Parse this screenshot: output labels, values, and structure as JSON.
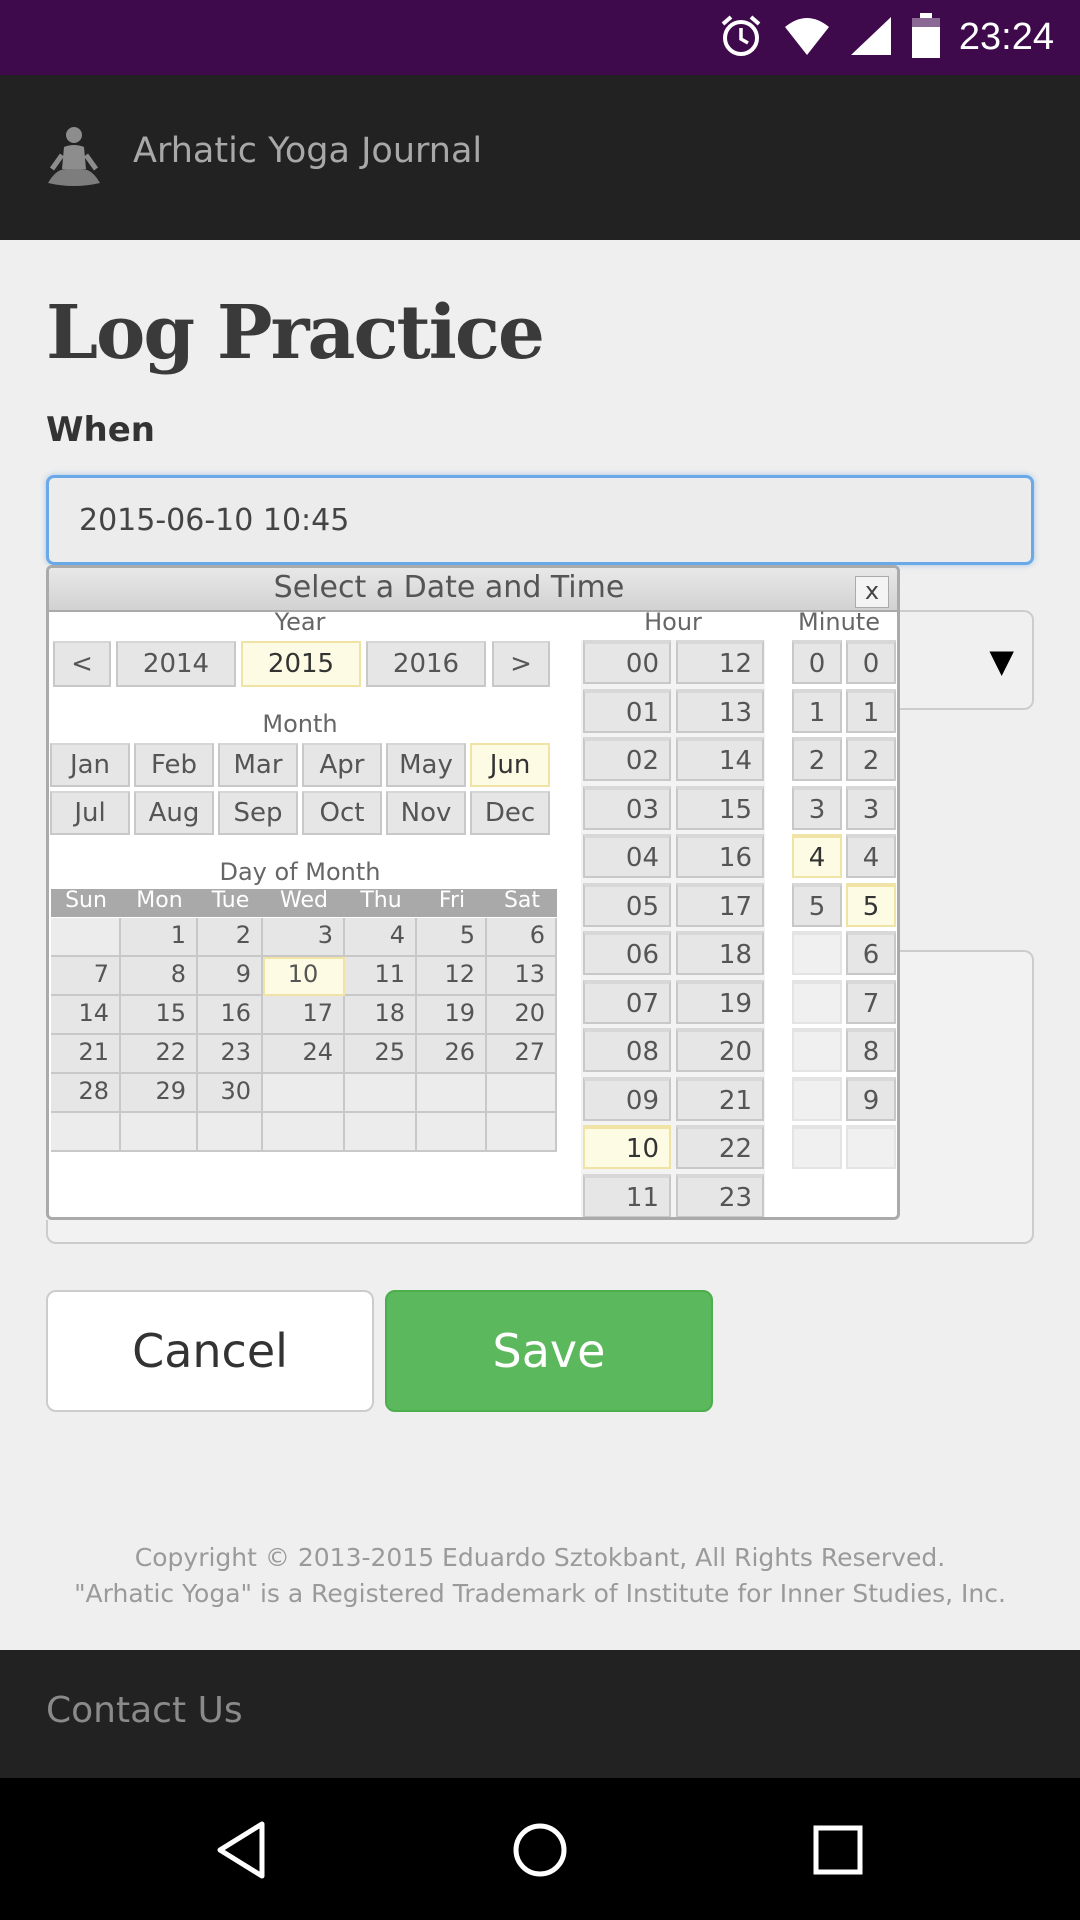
{
  "status_bar": {
    "time": "23:24",
    "icons": [
      "alarm-icon",
      "wifi-icon",
      "signal-icon",
      "battery-icon"
    ]
  },
  "app_bar": {
    "title": "Arhatic Yoga Journal",
    "logo_icon": "meditating-figure-icon"
  },
  "page": {
    "title": "Log Practice",
    "when_label": "When",
    "when_value": "2015-06-10 10:45",
    "select_arrow": "▼"
  },
  "picker": {
    "title": "Select a Date and Time",
    "close_label": "x",
    "year_label": "Year",
    "prev_label": "<",
    "next_label": ">",
    "years": [
      "2014",
      "2015",
      "2016"
    ],
    "selected_year": "2015",
    "month_label": "Month",
    "months": [
      "Jan",
      "Feb",
      "Mar",
      "Apr",
      "May",
      "Jun",
      "Jul",
      "Aug",
      "Sep",
      "Oct",
      "Nov",
      "Dec"
    ],
    "selected_month": "Jun",
    "day_label": "Day of Month",
    "weekdays": [
      "Sun",
      "Mon",
      "Tue",
      "Wed",
      "Thu",
      "Fri",
      "Sat"
    ],
    "weeks": [
      [
        "",
        "1",
        "2",
        "3",
        "4",
        "5",
        "6"
      ],
      [
        "7",
        "8",
        "9",
        "10",
        "11",
        "12",
        "13"
      ],
      [
        "14",
        "15",
        "16",
        "17",
        "18",
        "19",
        "20"
      ],
      [
        "21",
        "22",
        "23",
        "24",
        "25",
        "26",
        "27"
      ],
      [
        "28",
        "29",
        "30",
        "",
        "",
        "",
        ""
      ],
      [
        "",
        "",
        "",
        "",
        "",
        "",
        ""
      ]
    ],
    "selected_day": "10",
    "hour_label": "Hour",
    "hours_col1": [
      "00",
      "01",
      "02",
      "03",
      "04",
      "05",
      "06",
      "07",
      "08",
      "09",
      "10",
      "11"
    ],
    "hours_col2": [
      "12",
      "13",
      "14",
      "15",
      "16",
      "17",
      "18",
      "19",
      "20",
      "21",
      "22",
      "23"
    ],
    "selected_hour": "10",
    "minute_label": "Minute",
    "minute_tens": [
      "0",
      "1",
      "2",
      "3",
      "4",
      "5"
    ],
    "minute_ones": [
      "0",
      "1",
      "2",
      "3",
      "4",
      "5",
      "6",
      "7",
      "8",
      "9"
    ],
    "selected_minute_tens": "4",
    "selected_minute_ones": "5"
  },
  "buttons": {
    "cancel": "Cancel",
    "save": "Save"
  },
  "copyright": {
    "line1": "Copyright © 2013-2015 Eduardo Sztokbant, All Rights Reserved.",
    "line2": "\"Arhatic Yoga\" is a Registered Trademark of Institute for Inner Studies, Inc."
  },
  "footer": {
    "contact": "Contact Us"
  },
  "nav_bar": {
    "icons": [
      "back-icon",
      "home-icon",
      "recents-icon"
    ]
  },
  "colors": {
    "status_bar": "#3f0a4c",
    "app_bar": "#222222",
    "save_button": "#5cb85c",
    "selected_cell": "#fdfbe3",
    "input_focus_border": "#6aa9e8"
  }
}
